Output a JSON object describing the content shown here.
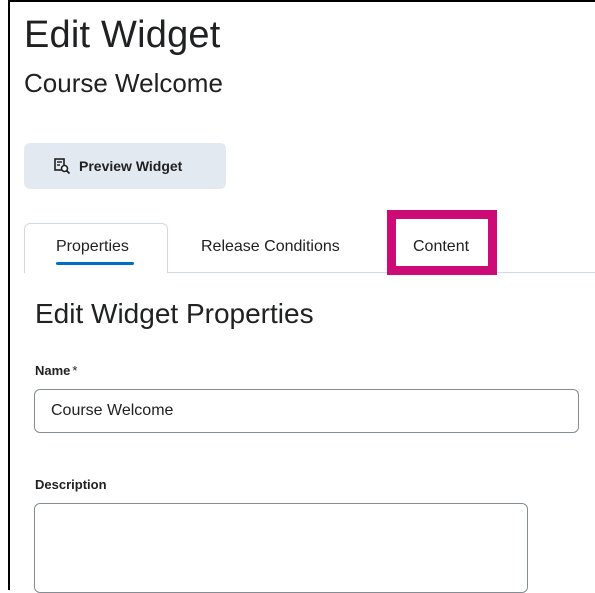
{
  "header": {
    "title": "Edit Widget",
    "subtitle": "Course Welcome"
  },
  "toolbar": {
    "preview_label": "Preview Widget",
    "preview_icon": "preview-icon"
  },
  "tabs": [
    {
      "label": "Properties",
      "selected": true
    },
    {
      "label": "Release Conditions",
      "selected": false
    },
    {
      "label": "Content",
      "selected": false,
      "highlighted": true
    }
  ],
  "colors": {
    "highlight": "#cc0b76",
    "tab_indicator": "#006fbf",
    "button_bg": "#e3e9f1"
  },
  "form": {
    "section_title": "Edit Widget Properties",
    "name_label": "Name",
    "name_required": "*",
    "name_value": "Course Welcome",
    "description_label": "Description",
    "description_value": ""
  }
}
